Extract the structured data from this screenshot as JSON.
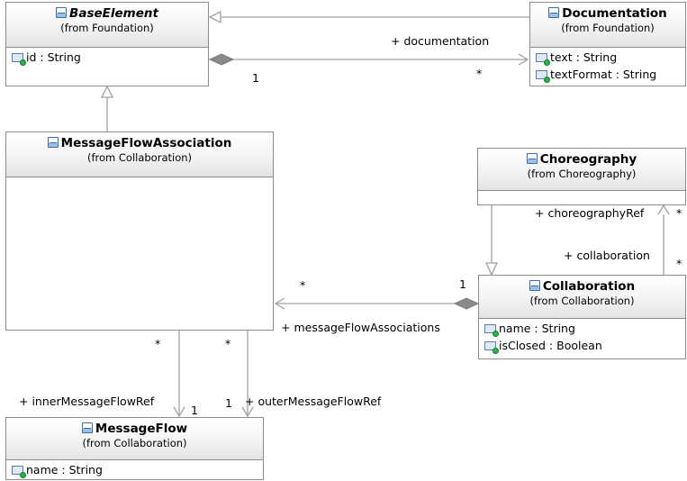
{
  "classes": {
    "base_element": {
      "name": "BaseElement",
      "from": "(from Foundation)",
      "attributes": [
        "id : String"
      ]
    },
    "documentation": {
      "name": "Documentation",
      "from": "(from Foundation)",
      "attributes": [
        "text : String",
        "textFormat : String"
      ]
    },
    "message_flow_association": {
      "name": "MessageFlowAssociation",
      "from": "(from Collaboration)",
      "attributes": []
    },
    "choreography": {
      "name": "Choreography",
      "from": "(from Choreography)",
      "attributes": []
    },
    "collaboration": {
      "name": "Collaboration",
      "from": "(from Collaboration)",
      "attributes": [
        "name : String",
        "isClosed : Boolean"
      ]
    },
    "message_flow": {
      "name": "MessageFlow",
      "from": "(from Collaboration)",
      "attributes": [
        "name : String"
      ]
    }
  },
  "associations": {
    "documentation": {
      "role": "+ documentation",
      "source_mult": "1",
      "target_mult": "*"
    },
    "choreography_ref": {
      "role": "+ choreographyRef",
      "mult": "*"
    },
    "collaboration": {
      "role": "+ collaboration",
      "mult": "*"
    },
    "message_flow_associations": {
      "role": "+ messageFlowAssociations",
      "source_mult": "1",
      "target_mult": "*"
    },
    "inner_message_flow_ref": {
      "role": "+ innerMessageFlowRef",
      "source_mult": "*",
      "target_mult": "1"
    },
    "outer_message_flow_ref": {
      "role": "+ outerMessageFlowRef",
      "source_mult": "*",
      "target_mult": "1"
    }
  },
  "colors": {
    "border": "#8c8c8c",
    "edge": "#a0a0a0",
    "diamond": "#8a8a8a",
    "class_icon": "#3b6ea8",
    "attr_dot": "#2db34a"
  }
}
